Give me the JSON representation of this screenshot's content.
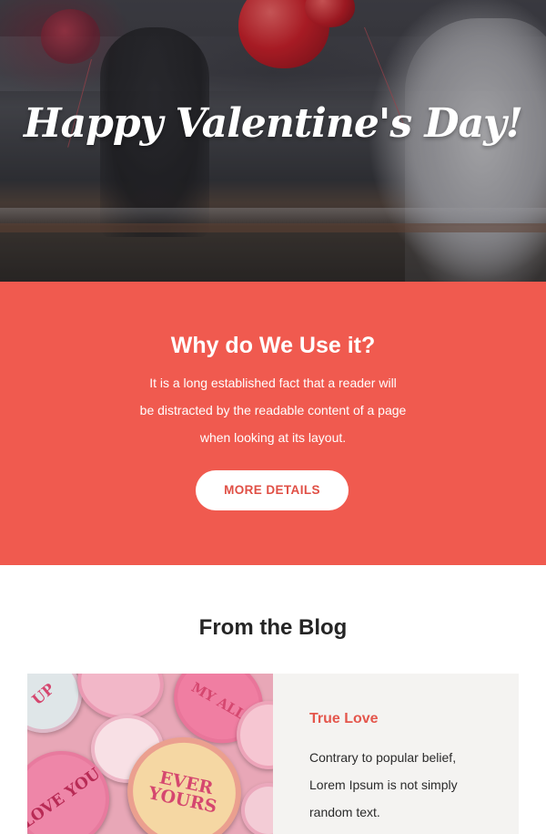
{
  "hero": {
    "title": "Happy Valentine's Day!"
  },
  "cta": {
    "heading": "Why do We Use it?",
    "body_lines": [
      "It is a long established fact that a reader will",
      "be distracted by the readable content of a page",
      "when looking at its layout."
    ],
    "button_label": "MORE DETAILS",
    "background_color": "#f05a4f"
  },
  "blog": {
    "title": "From the Blog",
    "post": {
      "title": "True Love",
      "excerpt_lines": [
        "Contrary to popular belief,",
        "Lorem Ipsum is not simply",
        "random text."
      ],
      "image_candies": [
        "LOVE YOU",
        "EVER YOURS",
        "MY ALL",
        "UP"
      ]
    },
    "accent_color": "#e4564c"
  }
}
